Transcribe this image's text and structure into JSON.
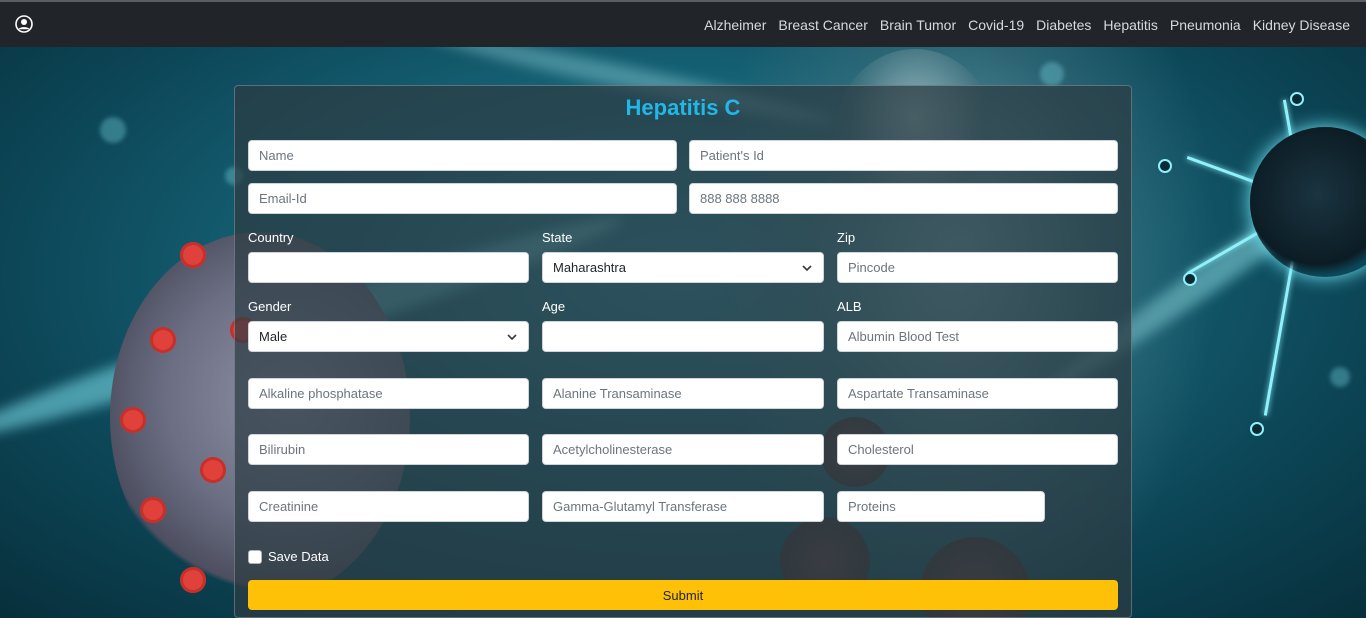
{
  "navbar": {
    "brand_icon": "user-circle-icon",
    "links": [
      "Alzheimer",
      "Breast Cancer",
      "Brain Tumor",
      "Covid-19",
      "Diabetes",
      "Hepatitis",
      "Pneumonia",
      "Kidney Disease"
    ]
  },
  "form": {
    "title": "Hepatitis C",
    "name_placeholder": "Name",
    "patient_id_placeholder": "Patient's Id",
    "email_placeholder": "Email-Id",
    "phone_placeholder": "888 888 8888",
    "country_label": "Country",
    "country_value": "",
    "state_label": "State",
    "state_value": "Maharashtra",
    "zip_label": "Zip",
    "zip_placeholder": "Pincode",
    "gender_label": "Gender",
    "gender_value": "Male",
    "age_label": "Age",
    "age_value": "",
    "alb_label": "ALB",
    "alb_placeholder": "Albumin Blood Test",
    "alp_placeholder": "Alkaline phosphatase",
    "alt_placeholder": "Alanine Transaminase",
    "ast_placeholder": "Aspartate Transaminase",
    "bil_placeholder": "Bilirubin",
    "che_placeholder": "Acetylcholinesterase",
    "chol_placeholder": "Cholesterol",
    "crea_placeholder": "Creatinine",
    "ggt_placeholder": "Gamma-Glutamyl Transferase",
    "prot_placeholder": "Proteins",
    "save_label": "Save Data",
    "submit_label": "Submit"
  },
  "colors": {
    "navbar_bg": "#212529",
    "title": "#22b7e6",
    "submit_bg": "#ffc107"
  }
}
